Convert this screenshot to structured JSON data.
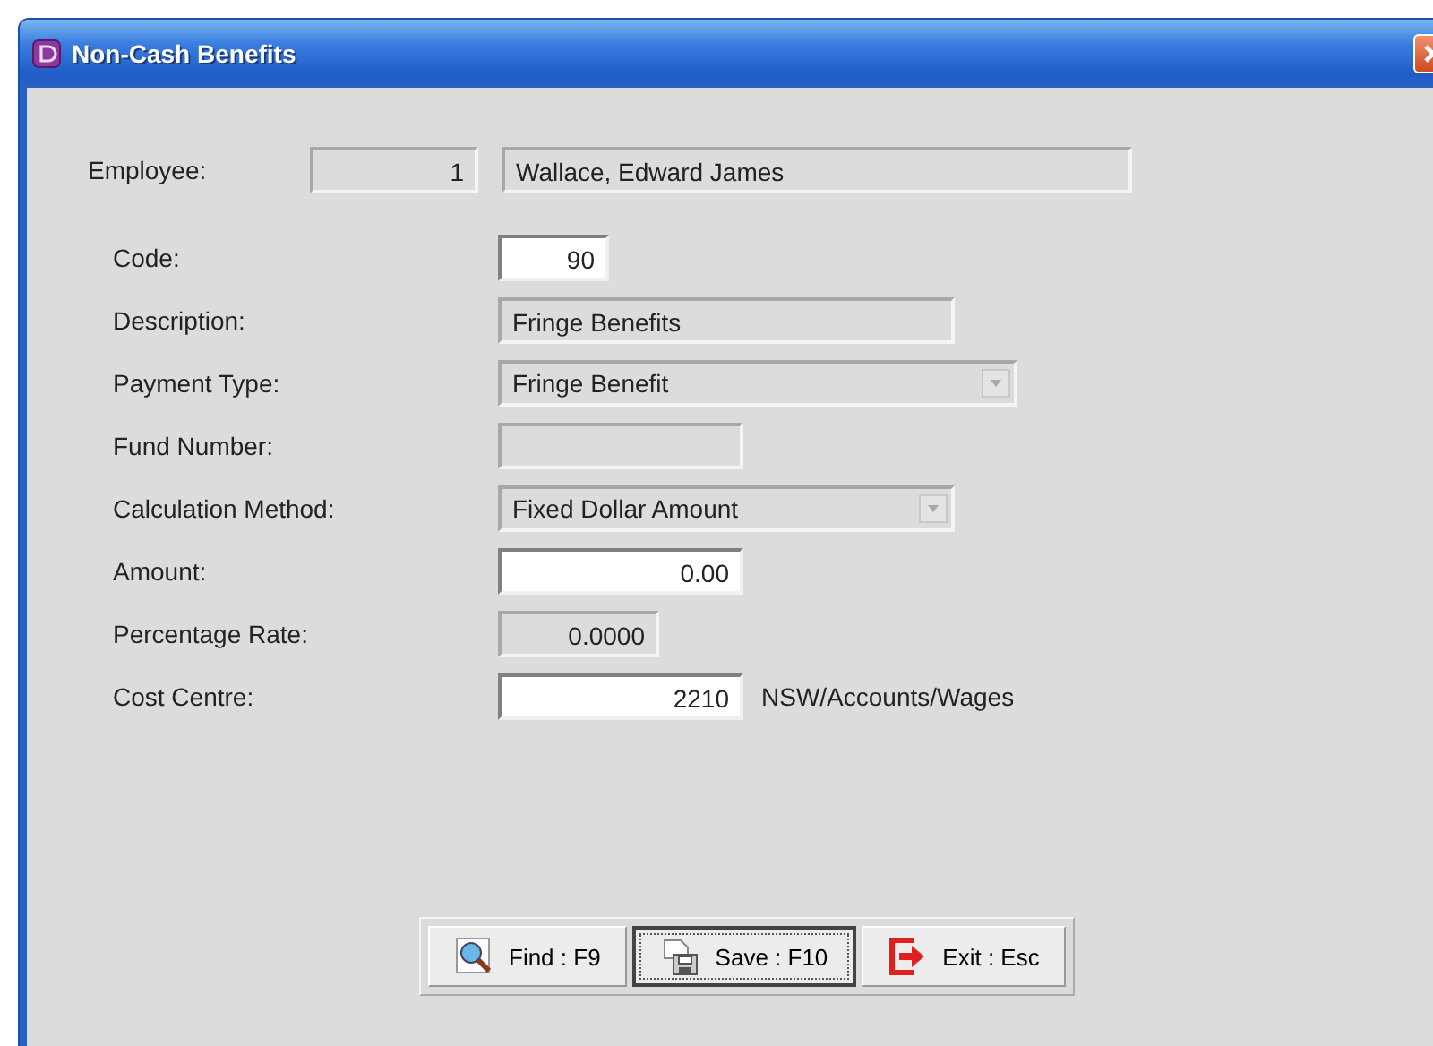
{
  "window": {
    "title": "Non-Cash Benefits"
  },
  "employee": {
    "label": "Employee:",
    "number": "1",
    "name": "Wallace, Edward James"
  },
  "fields": [
    {
      "label": "Code:",
      "kind": "number",
      "value": "90",
      "disabled": false
    },
    {
      "label": "Description:",
      "kind": "text",
      "value": "Fringe Benefits",
      "disabled": true
    },
    {
      "label": "Payment Type:",
      "kind": "combo",
      "value": "Fringe Benefit",
      "disabled": true
    },
    {
      "label": "Fund Number:",
      "kind": "text",
      "disabled": true
    },
    {
      "label": "Calculation Method:",
      "kind": "combo",
      "value": "Fixed Dollar Amount",
      "disabled": true
    },
    {
      "label": "Amount:",
      "kind": "number",
      "value": "0.00",
      "disabled": false
    },
    {
      "label": "Percentage Rate:",
      "kind": "number",
      "value": "0.0000",
      "disabled": true
    },
    {
      "label": "Cost Centre:",
      "kind": "number",
      "value": "2210",
      "disabled": false,
      "note": "NSW/Accounts/Wages"
    }
  ],
  "buttons": [
    {
      "label": "Find : F9",
      "kind": "find",
      "focused": false
    },
    {
      "label": "Save : F10",
      "kind": "save",
      "focused": true
    },
    {
      "label": "Exit : Esc",
      "kind": "exit",
      "focused": false
    }
  ]
}
